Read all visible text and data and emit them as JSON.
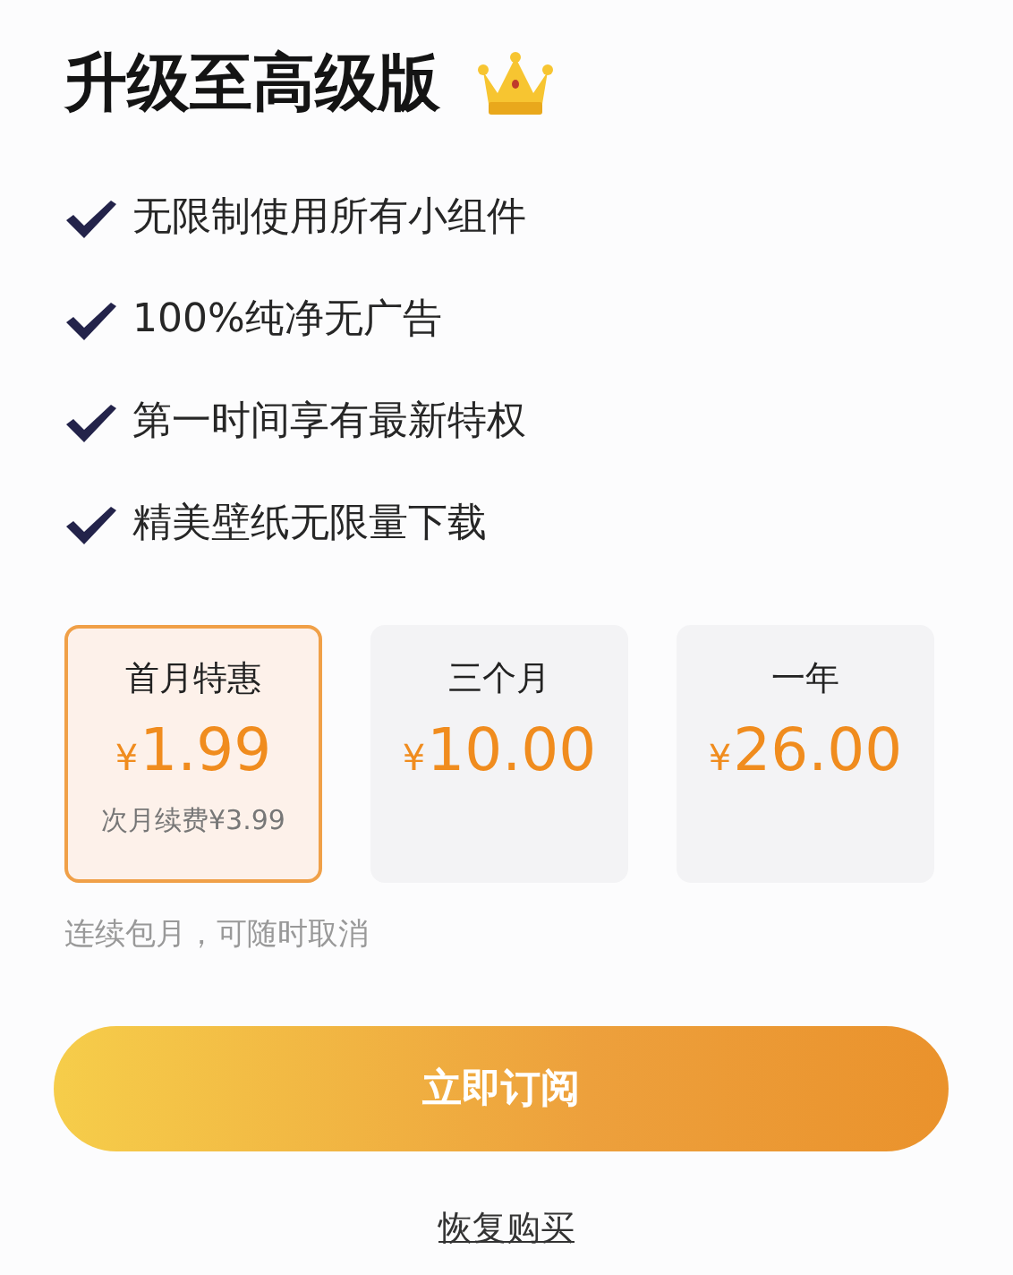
{
  "title": "升级至高级版",
  "features": [
    {
      "text": "无限制使用所有小组件"
    },
    {
      "text": "100%纯净无广告"
    },
    {
      "text": "第一时间享有最新特权"
    },
    {
      "text": "精美壁纸无限量下载"
    }
  ],
  "plans": [
    {
      "name": "首月特惠",
      "currency": "¥",
      "amount": "1.99",
      "renewal": "次月续费¥3.99",
      "selected": true
    },
    {
      "name": "三个月",
      "currency": "¥",
      "amount": "10.00",
      "selected": false
    },
    {
      "name": "一年",
      "currency": "¥",
      "amount": "26.00",
      "selected": false
    }
  ],
  "note": "连续包月，可随时取消",
  "subscribe_button": "立即订阅",
  "restore_link": "恢复购买"
}
